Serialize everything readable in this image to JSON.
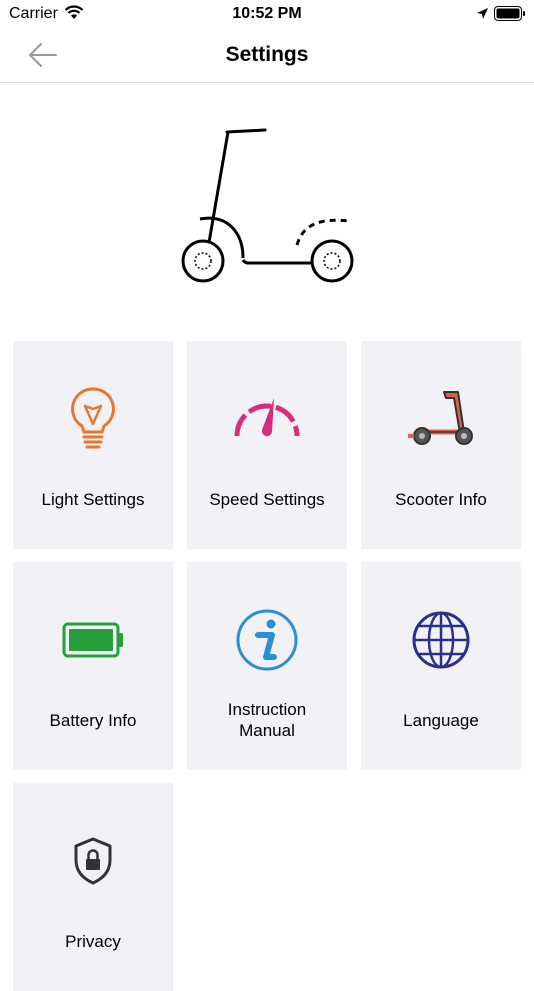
{
  "status_bar": {
    "carrier": "Carrier",
    "time": "10:52 PM"
  },
  "nav": {
    "title": "Settings",
    "back_icon": "arrow-left-icon"
  },
  "hero_icon": "scooter-outline-illustration",
  "tiles": [
    {
      "label": "Light Settings",
      "icon": "lightbulb-icon",
      "color": "#e8772e"
    },
    {
      "label": "Speed Settings",
      "icon": "speedometer-icon",
      "color": "#d62e7c"
    },
    {
      "label": "Scooter Info",
      "icon": "scooter-icon",
      "color": "#e0604a"
    },
    {
      "label": "Battery Info",
      "icon": "battery-icon",
      "color": "#26a03c"
    },
    {
      "label": "Instruction\nManual",
      "icon": "info-circle-icon",
      "color": "#2b8fd6"
    },
    {
      "label": "Language",
      "icon": "globe-icon",
      "color": "#2a2f8f"
    },
    {
      "label": "Privacy",
      "icon": "shield-lock-icon",
      "color": "#333333"
    }
  ]
}
